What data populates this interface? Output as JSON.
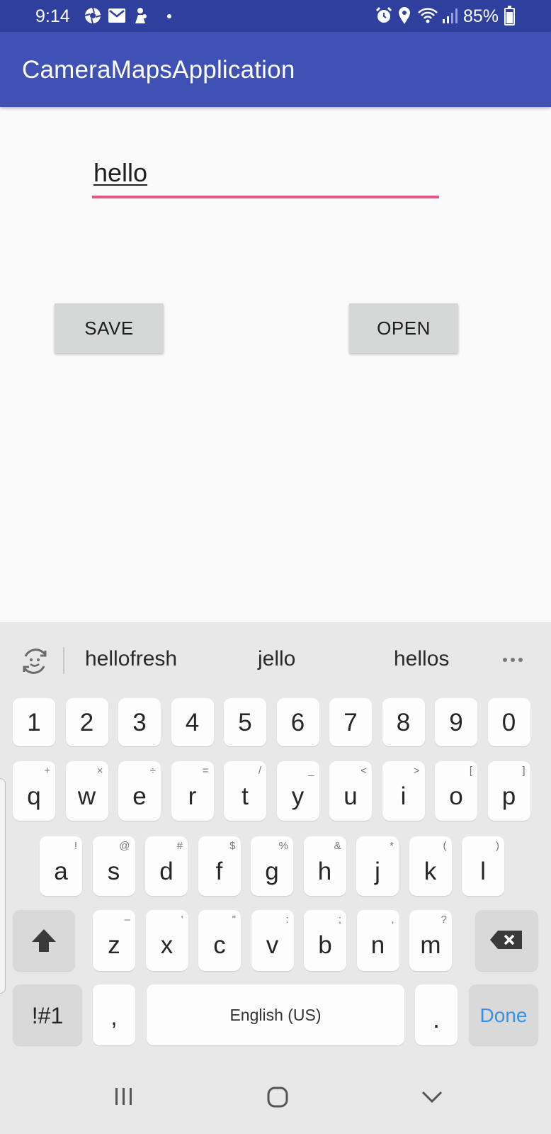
{
  "status_bar": {
    "time": "9:14",
    "icons_left": [
      "aperture-icon",
      "gmail-icon",
      "messenger-icon"
    ],
    "icons_right": [
      "alarm-icon",
      "location-icon",
      "wifi-icon",
      "signal-icon"
    ],
    "battery_percent_label": "85%",
    "battery_level": 0.85
  },
  "app_bar": {
    "title": "CameraMapsApplication",
    "color": "#3f51b5"
  },
  "editor": {
    "value": "hello",
    "accent_color": "#e0588a"
  },
  "buttons": {
    "save_label": "SAVE",
    "open_label": "OPEN"
  },
  "keyboard": {
    "suggestions": [
      "hellofresh",
      "jello",
      "hellos"
    ],
    "number_row": [
      "1",
      "2",
      "3",
      "4",
      "5",
      "6",
      "7",
      "8",
      "9",
      "0"
    ],
    "row1": [
      {
        "key": "q",
        "alt": "+"
      },
      {
        "key": "w",
        "alt": "×"
      },
      {
        "key": "e",
        "alt": "÷"
      },
      {
        "key": "r",
        "alt": "="
      },
      {
        "key": "t",
        "alt": "/"
      },
      {
        "key": "y",
        "alt": "_"
      },
      {
        "key": "u",
        "alt": "<"
      },
      {
        "key": "i",
        "alt": ">"
      },
      {
        "key": "o",
        "alt": "["
      },
      {
        "key": "p",
        "alt": "]"
      }
    ],
    "row2": [
      {
        "key": "a",
        "alt": "!"
      },
      {
        "key": "s",
        "alt": "@"
      },
      {
        "key": "d",
        "alt": "#"
      },
      {
        "key": "f",
        "alt": "$"
      },
      {
        "key": "g",
        "alt": "%"
      },
      {
        "key": "h",
        "alt": "&"
      },
      {
        "key": "j",
        "alt": "*"
      },
      {
        "key": "k",
        "alt": "("
      },
      {
        "key": "l",
        "alt": ")"
      }
    ],
    "row3": [
      {
        "key": "z",
        "alt": "–"
      },
      {
        "key": "x",
        "alt": "'"
      },
      {
        "key": "c",
        "alt": "\""
      },
      {
        "key": "v",
        "alt": ":"
      },
      {
        "key": "b",
        "alt": ";"
      },
      {
        "key": "n",
        "alt": ","
      },
      {
        "key": "m",
        "alt": "?"
      }
    ],
    "symbols_label": "!#1",
    "comma_label": ",",
    "space_label": "English (US)",
    "period_label": ".",
    "done_label": "Done",
    "done_color": "#3b8fe0"
  },
  "nav_bar": {
    "icons": [
      "recents-icon",
      "home-icon",
      "back-icon"
    ]
  }
}
